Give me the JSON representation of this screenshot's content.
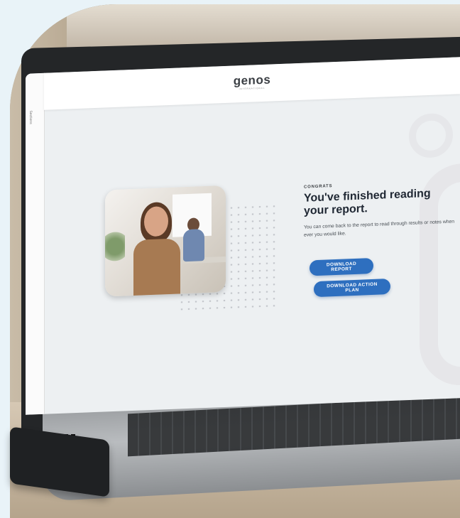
{
  "app": {
    "brand": "genos",
    "brand_sub": "INTERNATIONAL",
    "sidebar_label": "Sections"
  },
  "main": {
    "eyebrow": "CONGRATS",
    "headline": "You've finished reading your report.",
    "body": "You can come back to the report to read through results or notes when ever you would like.",
    "buttons": {
      "download_report": "DOWNLOAD REPORT",
      "download_action_plan": "DOWNLOAD ACTION PLAN"
    }
  },
  "colors": {
    "accent": "#2e6fbf",
    "frame_bg": "#e9f3f8",
    "screen_bg": "#edf0f2"
  }
}
